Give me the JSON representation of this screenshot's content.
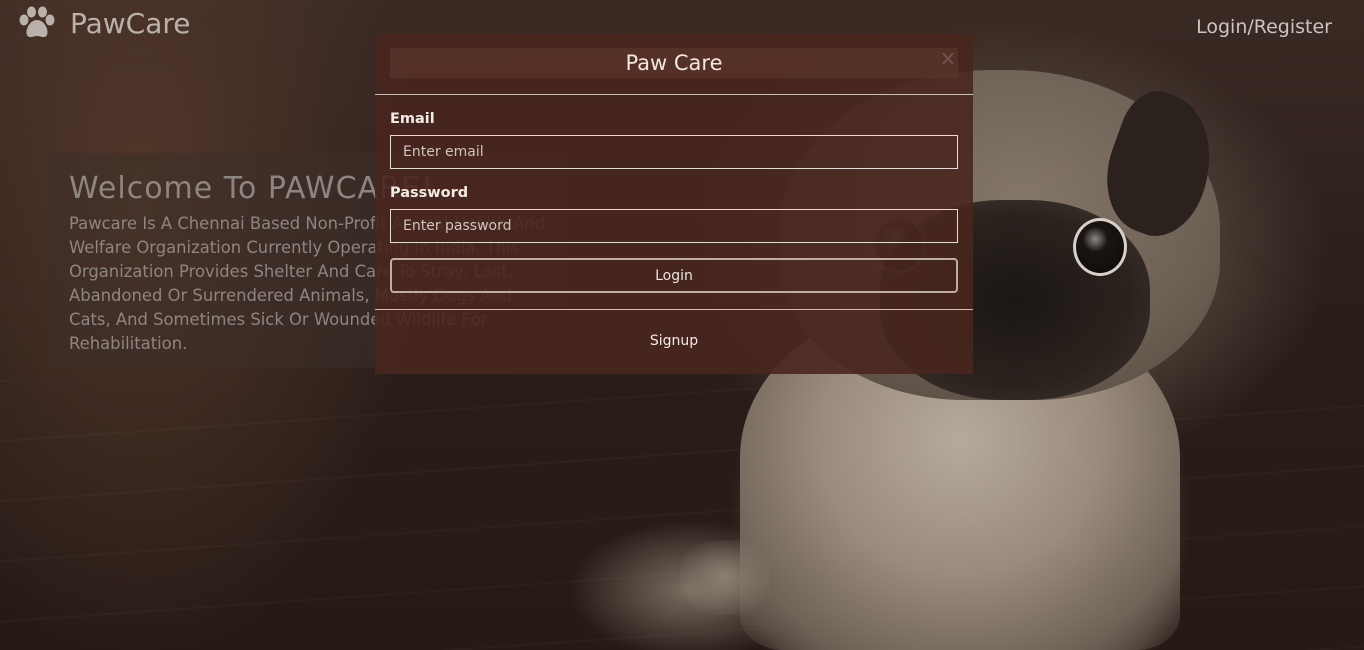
{
  "navbar": {
    "brand": "PawCare",
    "brand_icon": "paw-icon",
    "login_register": "Login/Register"
  },
  "welcome": {
    "title": "Welcome To PAWCARE!",
    "description": "Pawcare Is A Chennai Based Non-Profit Animal Health And Welfare Organization Currently Operating In India. This Organization Provides Shelter And Care To Stray, Lost, Abandoned Or Surrendered Animals, Mostly Dogs And Cats, And Sometimes Sick Or Wounded Wildlife For Rehabilitation."
  },
  "modal": {
    "title": "Paw Care",
    "close_icon": "close-icon",
    "email_label": "Email",
    "email_placeholder": "Enter email",
    "email_value": "",
    "password_label": "Password",
    "password_placeholder": "Enter password",
    "password_value": "",
    "login_label": "Login",
    "signup_label": "Signup"
  },
  "colors": {
    "modal_bg": "#48261e",
    "text_light": "#f2ece6",
    "muted_text": "#8d8680"
  }
}
